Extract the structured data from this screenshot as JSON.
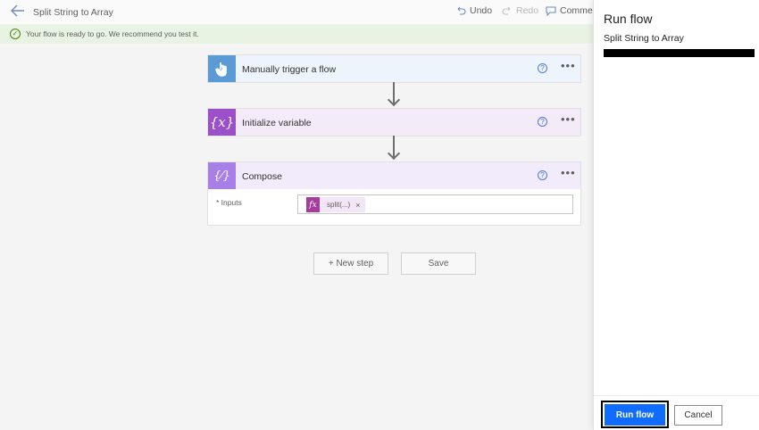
{
  "topbar": {
    "title": "Split String to Array",
    "undo_label": "Undo",
    "redo_label": "Redo",
    "comments_label": "Comme"
  },
  "banner": {
    "text": "Your flow is ready to go. We recommend you test it."
  },
  "steps": [
    {
      "title": "Manually trigger a flow",
      "icon": "touch-icon",
      "color": "#5b9bd5"
    },
    {
      "title": "Initialize variable",
      "icon": "variable-icon",
      "color": "#9b4fc9",
      "glyph": "{x}"
    },
    {
      "title": "Compose",
      "icon": "compose-icon",
      "color": "#a77fe6",
      "glyph": "{⁄}"
    }
  ],
  "compose": {
    "inputs_label": "* Inputs",
    "token_label": "split(...)",
    "token_icon_glyph": "fx",
    "token_close": "×"
  },
  "canvas_actions": {
    "new_step_label": "+ New step",
    "save_label": "Save"
  },
  "panel": {
    "title": "Run flow",
    "flow_name": "Split String to Array",
    "run_label": "Run flow",
    "cancel_label": "Cancel"
  },
  "colors": {
    "accent": "#0f6cff",
    "banner_bg": "#e8f3e3",
    "success": "#498205"
  }
}
